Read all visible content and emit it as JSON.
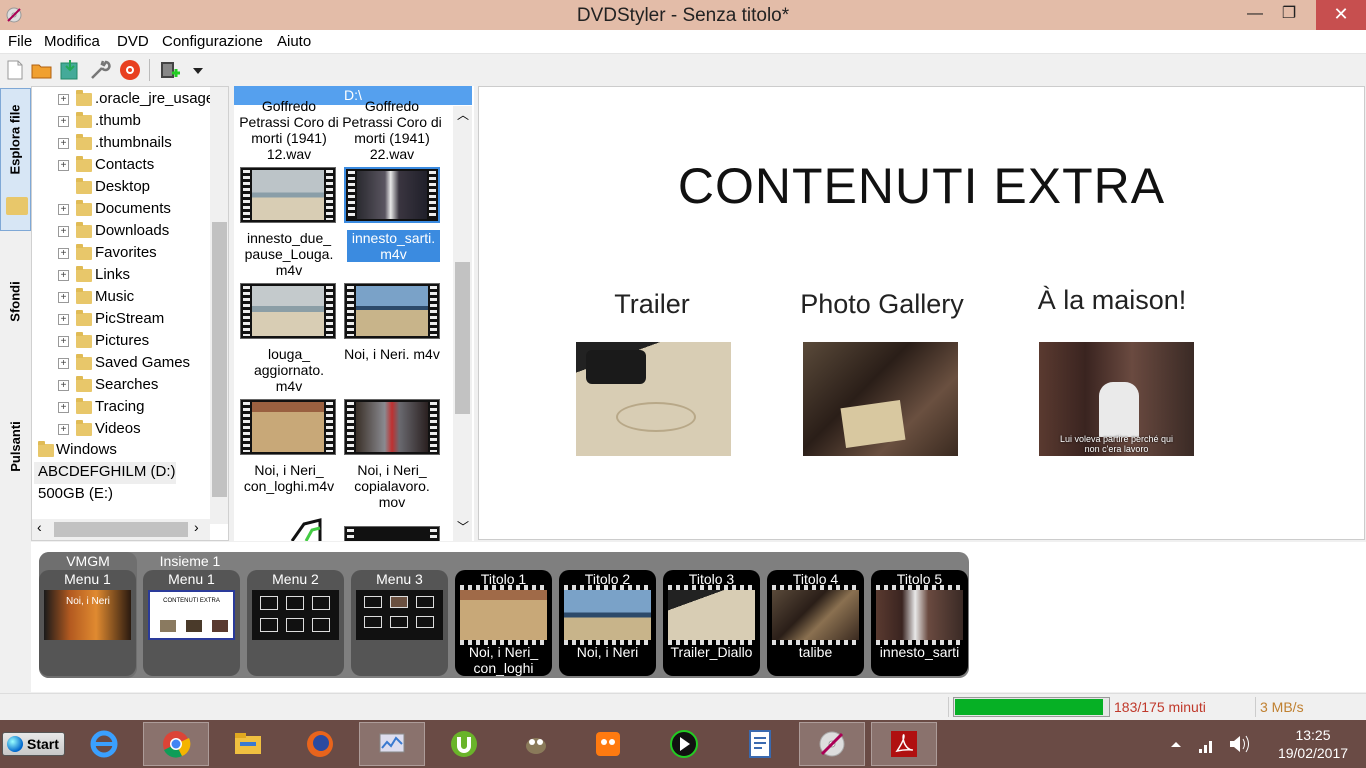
{
  "window": {
    "title": "DVDStyler - Senza titolo*"
  },
  "menubar": [
    "File",
    "Modifica",
    "DVD",
    "Configurazione",
    "Aiuto"
  ],
  "side_tabs": [
    "Esplora file",
    "Sfondi",
    "Pulsanti"
  ],
  "tree": {
    "folders": [
      ".oracle_jre_usage",
      ".thumb",
      ".thumbnails",
      "Contacts",
      "Desktop",
      "Documents",
      "Downloads",
      "Favorites",
      "Links",
      "Music",
      "PicStream",
      "Pictures",
      "Saved Games",
      "Searches",
      "Tracing",
      "Videos"
    ],
    "windows": "Windows",
    "drive_d": "ABCDEFGHILM (D:)",
    "drive_e": "500GB (E:)"
  },
  "files": {
    "path": "D:\\",
    "items": [
      "Goffredo Petrassi Coro di morti (1941) 12.wav",
      "Goffredo Petrassi Coro di morti (1941) 22.wav",
      "innesto_due_ pause_Louga. m4v",
      "innesto_sarti. m4v",
      "louga_ aggiornato. m4v",
      "Noi, i Neri. m4v",
      "Noi, i Neri_ con_loghi.m4v",
      "Noi, i Neri_ copialavoro. mov"
    ]
  },
  "preview": {
    "title": "CONTENUTI EXTRA",
    "buttons": [
      "Trailer",
      "Photo Gallery",
      "À la maison!"
    ],
    "subtitle": "Lui voleva partire perché qui non c'era lavoro"
  },
  "titleset": {
    "vmgm_label": "VMGM",
    "set_label": "Insieme 1",
    "menus": [
      "Menu 1",
      "Menu 1",
      "Menu 2",
      "Menu 3"
    ],
    "titles": [
      {
        "name": "Titolo 1",
        "caption": "Noi, i Neri_ con_loghi"
      },
      {
        "name": "Titolo 2",
        "caption": "Noi, i Neri"
      },
      {
        "name": "Titolo 3",
        "caption": "Trailer_Diallo"
      },
      {
        "name": "Titolo 4",
        "caption": "talibe"
      },
      {
        "name": "Titolo 5",
        "caption": "innesto_sarti"
      }
    ],
    "menu_preview_text": [
      "Noi, i Neri",
      "CONTENUTI EXTRA"
    ]
  },
  "status": {
    "progress_fraction": 0.97,
    "minutes": "183/175 minuti",
    "speed": "3 MB/s",
    "progress_color": "#06b025"
  },
  "taskbar": {
    "start": "Start",
    "time": "13:25",
    "date": "19/02/2017",
    "apps": [
      "internet-explorer-icon",
      "chrome-icon",
      "file-explorer-icon",
      "firefox-icon",
      "resource-monitor-icon",
      "utorrent-icon",
      "gimp-icon",
      "vlc-icon",
      "media-player-icon",
      "document-icon",
      "dvdstyler-icon",
      "acrobat-icon"
    ]
  }
}
